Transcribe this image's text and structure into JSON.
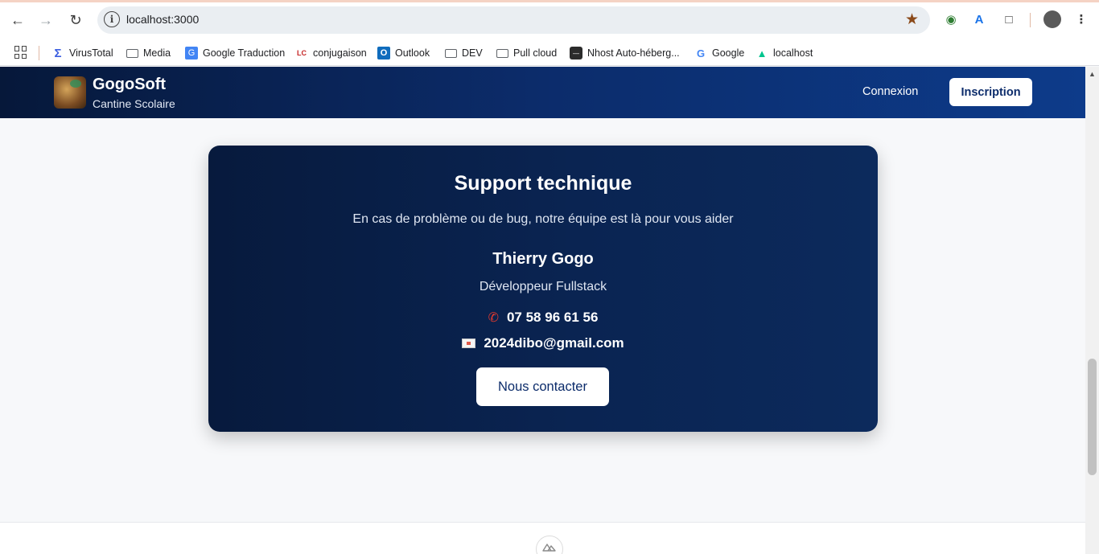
{
  "browser": {
    "url": "localhost:3000",
    "bookmarks": [
      {
        "label": "VirusTotal",
        "icon": "virustotal-icon"
      },
      {
        "label": "Media",
        "icon": "folder-icon"
      },
      {
        "label": "Google Traduction",
        "icon": "google-translate-icon"
      },
      {
        "label": "conjugaison",
        "icon": "conjugaison-icon"
      },
      {
        "label": "Outlook",
        "icon": "outlook-icon"
      },
      {
        "label": "DEV",
        "icon": "folder-icon"
      },
      {
        "label": "Pull cloud",
        "icon": "folder-icon"
      },
      {
        "label": "Nhost Auto-héberg...",
        "icon": "nhost-icon"
      },
      {
        "label": "Google",
        "icon": "google-icon"
      },
      {
        "label": "localhost",
        "icon": "nuxt-icon"
      }
    ]
  },
  "header": {
    "brand": "GogoSoft",
    "tagline": "Cantine Scolaire",
    "login_label": "Connexion",
    "signup_label": "Inscription"
  },
  "support": {
    "title": "Support technique",
    "subtitle": "En cas de problème ou de bug, notre équipe est là pour vous aider",
    "name": "Thierry Gogo",
    "role": "Développeur Fullstack",
    "phone": "07 58 96 61 56",
    "email": "2024dibo@gmail.com",
    "contact_button": "Nous contacter"
  },
  "colors": {
    "header_start": "#06183a",
    "header_end": "#0d3b8a",
    "card_bg": "#0a2452",
    "button_text": "#0c2c6b"
  }
}
